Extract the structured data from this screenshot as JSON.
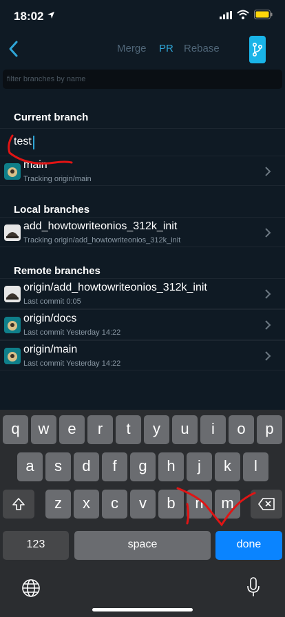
{
  "status": {
    "time": "18:02"
  },
  "header": {
    "segments": [
      {
        "label": "Merge",
        "active": false
      },
      {
        "label": "PR",
        "active": true
      },
      {
        "label": "Rebase",
        "active": false
      }
    ]
  },
  "filter": {
    "placeholder": "filter branches by name"
  },
  "current": {
    "title": "Current branch",
    "input_value": "test",
    "rows": [
      {
        "title": "main",
        "sub": "Tracking origin/main"
      }
    ]
  },
  "local": {
    "title": "Local branches",
    "rows": [
      {
        "title": "add_howtowriteonios_312k_init",
        "sub": "Tracking origin/add_howtowriteonios_312k_init"
      }
    ]
  },
  "remote": {
    "title": "Remote branches",
    "rows": [
      {
        "title": "origin/add_howtowriteonios_312k_init",
        "sub": "Last commit 0:05"
      },
      {
        "title": "origin/docs",
        "sub": "Last commit Yesterday 14:22"
      },
      {
        "title": "origin/main",
        "sub": "Last commit Yesterday 14:22"
      }
    ]
  },
  "keyboard": {
    "row1": [
      "q",
      "w",
      "e",
      "r",
      "t",
      "y",
      "u",
      "i",
      "o",
      "p"
    ],
    "row2": [
      "a",
      "s",
      "d",
      "f",
      "g",
      "h",
      "j",
      "k",
      "l"
    ],
    "row3": [
      "z",
      "x",
      "c",
      "v",
      "b",
      "n",
      "m"
    ],
    "numbers_label": "123",
    "space_label": "space",
    "done_label": "done"
  },
  "colors": {
    "accent": "#2fa6d8",
    "background": "#0f1a24",
    "done_key": "#0a84ff"
  }
}
